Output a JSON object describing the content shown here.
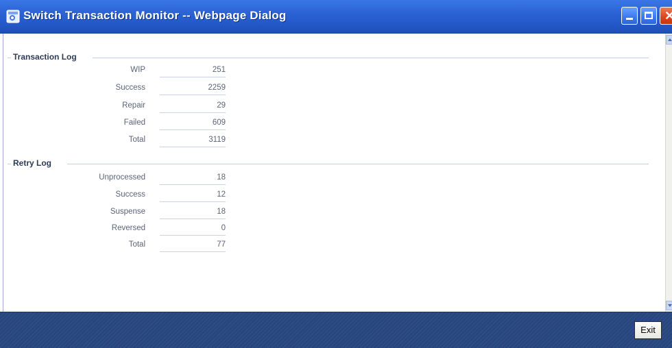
{
  "window": {
    "title": "Switch Transaction Monitor -- Webpage Dialog"
  },
  "transaction_log": {
    "title": "Transaction Log",
    "rows": [
      {
        "label": "WIP",
        "value": "251"
      },
      {
        "label": "Success",
        "value": "2259"
      },
      {
        "label": "Repair",
        "value": "29"
      },
      {
        "label": "Failed",
        "value": "609"
      },
      {
        "label": "Total",
        "value": "3119"
      }
    ]
  },
  "retry_log": {
    "title": "Retry Log",
    "rows": [
      {
        "label": "Unprocessed",
        "value": "18"
      },
      {
        "label": "Success",
        "value": "12"
      },
      {
        "label": "Suspense",
        "value": "18"
      },
      {
        "label": "Reversed",
        "value": "0"
      },
      {
        "label": "Total",
        "value": "77"
      }
    ]
  },
  "footer": {
    "exit_label": "Exit"
  },
  "icons": {
    "app": "ie-page-icon",
    "minimize": "minimize-icon",
    "maximize": "maximize-icon",
    "close": "close-icon"
  },
  "colors": {
    "titlebar": "#2b62d4",
    "footer": "#27467f",
    "section_title": "#2c3a55",
    "field_text": "#5a6478"
  }
}
